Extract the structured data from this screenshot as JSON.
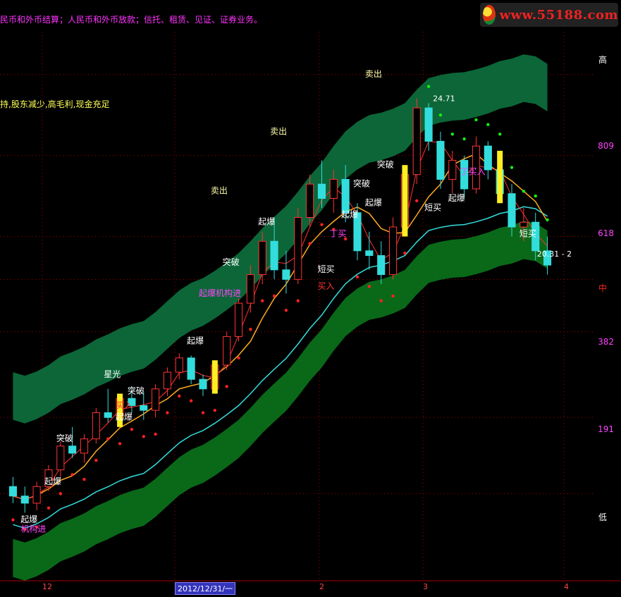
{
  "header": {
    "business_scope": "民币和外币结算；人民币和外币放款；信托、租赁、见证、证券业务。",
    "side_note": "持,股东减少,高毛利,现金充足"
  },
  "logo": {
    "site": "www.55188.com",
    "icon": "swirl-logo-icon"
  },
  "chart_data": {
    "type": "candlestick",
    "x_axis_labels": [
      "12",
      "2012/12/31/一",
      "2",
      "3",
      "4"
    ],
    "y_axis_labels": [
      {
        "text": "高",
        "color": "#ffffff"
      },
      {
        "text": "809",
        "color": "#ff44ff"
      },
      {
        "text": "618",
        "color": "#ff44ff"
      },
      {
        "text": "中",
        "color": "#ff2222"
      },
      {
        "text": "382",
        "color": "#ff44ff"
      },
      {
        "text": "191",
        "color": "#ff44ff"
      },
      {
        "text": "低",
        "color": "#ffffff"
      }
    ],
    "price_ylim": [
      15.0,
      26.5
    ],
    "price_labels": {
      "high": "24.71",
      "last": "20.31 - 2"
    },
    "y_fib_levels": [
      {
        "label": "高",
        "value": 25.6
      },
      {
        "label": "809",
        "value": 23.9
      },
      {
        "label": "618",
        "value": 22.2
      },
      {
        "label": "中",
        "value": 21.3
      },
      {
        "label": "382",
        "value": 20.2
      },
      {
        "label": "191",
        "value": 18.4
      },
      {
        "label": "低",
        "value": 16.8
      }
    ],
    "candles": [
      {
        "o": 16.95,
        "h": 17.15,
        "l": 16.6,
        "c": 16.75
      },
      {
        "o": 16.75,
        "h": 16.95,
        "l": 16.4,
        "c": 16.6
      },
      {
        "o": 16.6,
        "h": 17.05,
        "l": 16.45,
        "c": 16.95
      },
      {
        "o": 16.95,
        "h": 17.4,
        "l": 16.85,
        "c": 17.3
      },
      {
        "o": 17.3,
        "h": 17.9,
        "l": 17.15,
        "c": 17.8
      },
      {
        "o": 17.8,
        "h": 18.2,
        "l": 17.55,
        "c": 17.65
      },
      {
        "o": 17.65,
        "h": 18.05,
        "l": 17.45,
        "c": 17.95
      },
      {
        "o": 17.95,
        "h": 18.6,
        "l": 17.85,
        "c": 18.5
      },
      {
        "o": 18.5,
        "h": 19.0,
        "l": 18.3,
        "c": 18.4
      },
      {
        "o": 18.4,
        "h": 18.9,
        "l": 18.2,
        "c": 18.8
      },
      {
        "o": 18.8,
        "h": 19.05,
        "l": 18.5,
        "c": 18.65
      },
      {
        "o": 18.65,
        "h": 18.95,
        "l": 18.35,
        "c": 18.55
      },
      {
        "o": 18.55,
        "h": 19.1,
        "l": 18.4,
        "c": 19.0
      },
      {
        "o": 19.0,
        "h": 19.45,
        "l": 18.85,
        "c": 19.35
      },
      {
        "o": 19.35,
        "h": 19.75,
        "l": 19.2,
        "c": 19.65
      },
      {
        "o": 19.65,
        "h": 19.7,
        "l": 19.1,
        "c": 19.2
      },
      {
        "o": 19.2,
        "h": 19.3,
        "l": 18.85,
        "c": 19.0
      },
      {
        "o": 19.0,
        "h": 19.6,
        "l": 18.9,
        "c": 19.5
      },
      {
        "o": 19.5,
        "h": 20.2,
        "l": 19.4,
        "c": 20.1
      },
      {
        "o": 20.1,
        "h": 20.9,
        "l": 20.0,
        "c": 20.8
      },
      {
        "o": 20.8,
        "h": 21.6,
        "l": 20.6,
        "c": 21.4
      },
      {
        "o": 21.4,
        "h": 22.3,
        "l": 21.2,
        "c": 22.1
      },
      {
        "o": 22.1,
        "h": 22.6,
        "l": 21.3,
        "c": 21.5
      },
      {
        "o": 21.5,
        "h": 21.9,
        "l": 21.0,
        "c": 21.3
      },
      {
        "o": 21.3,
        "h": 22.8,
        "l": 21.2,
        "c": 22.6
      },
      {
        "o": 22.6,
        "h": 23.5,
        "l": 22.4,
        "c": 23.3
      },
      {
        "o": 23.3,
        "h": 23.8,
        "l": 22.8,
        "c": 23.0
      },
      {
        "o": 23.0,
        "h": 23.6,
        "l": 22.7,
        "c": 23.4
      },
      {
        "o": 23.4,
        "h": 23.7,
        "l": 22.5,
        "c": 22.7
      },
      {
        "o": 22.7,
        "h": 22.9,
        "l": 21.7,
        "c": 21.9
      },
      {
        "o": 21.9,
        "h": 22.3,
        "l": 21.5,
        "c": 21.8
      },
      {
        "o": 21.8,
        "h": 22.1,
        "l": 21.2,
        "c": 21.4
      },
      {
        "o": 21.4,
        "h": 22.6,
        "l": 21.3,
        "c": 22.4
      },
      {
        "o": 22.4,
        "h": 23.7,
        "l": 22.2,
        "c": 23.5
      },
      {
        "o": 23.5,
        "h": 25.1,
        "l": 23.3,
        "c": 24.9
      },
      {
        "o": 24.9,
        "h": 25.0,
        "l": 24.0,
        "c": 24.2
      },
      {
        "o": 24.2,
        "h": 24.4,
        "l": 23.2,
        "c": 23.4
      },
      {
        "o": 23.4,
        "h": 24.0,
        "l": 23.1,
        "c": 23.8
      },
      {
        "o": 23.8,
        "h": 23.9,
        "l": 23.0,
        "c": 23.2
      },
      {
        "o": 23.2,
        "h": 24.3,
        "l": 23.1,
        "c": 24.1
      },
      {
        "o": 24.1,
        "h": 24.2,
        "l": 23.4,
        "c": 23.6
      },
      {
        "o": 23.6,
        "h": 24.0,
        "l": 22.9,
        "c": 23.1
      },
      {
        "o": 23.1,
        "h": 23.3,
        "l": 22.2,
        "c": 22.4
      },
      {
        "o": 22.4,
        "h": 22.8,
        "l": 22.1,
        "c": 22.5
      },
      {
        "o": 22.5,
        "h": 22.7,
        "l": 21.7,
        "c": 21.9
      },
      {
        "o": 21.9,
        "h": 22.2,
        "l": 21.4,
        "c": 21.6
      }
    ],
    "annotations": [
      {
        "text": "起爆",
        "color": "#ffffff",
        "i": 1,
        "v": 16.2
      },
      {
        "text": "机构进",
        "color": "#ff44ff",
        "i": 1,
        "v": 16.0
      },
      {
        "text": "起爆",
        "color": "#ffffff",
        "i": 3,
        "v": 17.0
      },
      {
        "text": "突破",
        "color": "#ffffff",
        "i": 4,
        "v": 17.9
      },
      {
        "text": "起爆",
        "color": "#ffffff",
        "i": 9,
        "v": 18.35
      },
      {
        "text": "买入",
        "color": "#ff3333",
        "i": 9,
        "v": 18.6
      },
      {
        "text": "突破",
        "color": "#ffffff",
        "i": 10,
        "v": 18.9
      },
      {
        "text": "星光",
        "color": "#ffffff",
        "i": 8,
        "v": 19.25
      },
      {
        "text": "起爆",
        "color": "#ffffff",
        "i": 15,
        "v": 19.95
      },
      {
        "text": "起爆机构进",
        "color": "#ff44ff",
        "i": 16,
        "v": 20.95
      },
      {
        "text": "突破",
        "color": "#ffffff",
        "i": 18,
        "v": 21.6
      },
      {
        "text": "卖出",
        "color": "#ffffaa",
        "i": 17,
        "v": 23.1
      },
      {
        "text": "起爆",
        "color": "#ffffff",
        "i": 21,
        "v": 22.45
      },
      {
        "text": "卖出",
        "color": "#ffffaa",
        "i": 22,
        "v": 24.35
      },
      {
        "text": "短买",
        "color": "#ffffff",
        "i": 26,
        "v": 21.45
      },
      {
        "text": "买入",
        "color": "#ff3333",
        "i": 26,
        "v": 21.1
      },
      {
        "text": "丁买",
        "color": "#ff44ff",
        "i": 27,
        "v": 22.2
      },
      {
        "text": "起爆",
        "color": "#ffffff",
        "i": 28,
        "v": 22.6
      },
      {
        "text": "突破",
        "color": "#ffffff",
        "i": 29,
        "v": 23.25
      },
      {
        "text": "起爆",
        "color": "#ffffff",
        "i": 30,
        "v": 22.85
      },
      {
        "text": "突破",
        "color": "#ffffff",
        "i": 31,
        "v": 23.65
      },
      {
        "text": "卖出",
        "color": "#ffffaa",
        "i": 30,
        "v": 25.55
      },
      {
        "text": "短买",
        "color": "#ffffff",
        "i": 35,
        "v": 22.75
      },
      {
        "text": "起爆",
        "color": "#ffffff",
        "i": 37,
        "v": 22.95
      },
      {
        "text": "丁买入",
        "color": "#ff44ff",
        "i": 38,
        "v": 23.5
      },
      {
        "text": "短买",
        "color": "#ffffff",
        "i": 43,
        "v": 22.2
      }
    ]
  }
}
